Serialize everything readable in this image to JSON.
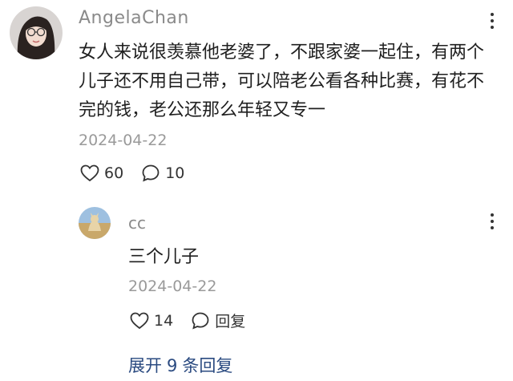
{
  "main_comment": {
    "username": "AngelaChan",
    "text": "女人来说很羡慕他老婆了，不跟家婆一起住，有两个儿子还不用自己带，可以陪老公看各种比赛，有花不完的钱，老公还那么年轻又专一",
    "date": "2024-04-22",
    "likes": "60",
    "comments": "10",
    "icons": {
      "like": "heart-icon",
      "comment": "comment-bubble-icon",
      "more": "more-vertical-icon"
    }
  },
  "reply": {
    "username": "cc",
    "text": "三个儿子",
    "date": "2024-04-22",
    "likes": "14",
    "reply_label": "回复",
    "icons": {
      "like": "heart-icon",
      "reply": "comment-bubble-icon",
      "more": "more-vertical-icon"
    }
  },
  "expand": {
    "prefix": "展开",
    "count": "9",
    "suffix": "条回复"
  },
  "colors": {
    "username": "#8a8a8a",
    "date": "#9a9a9a",
    "link": "#2a4a80",
    "text": "#1f1f1f"
  }
}
